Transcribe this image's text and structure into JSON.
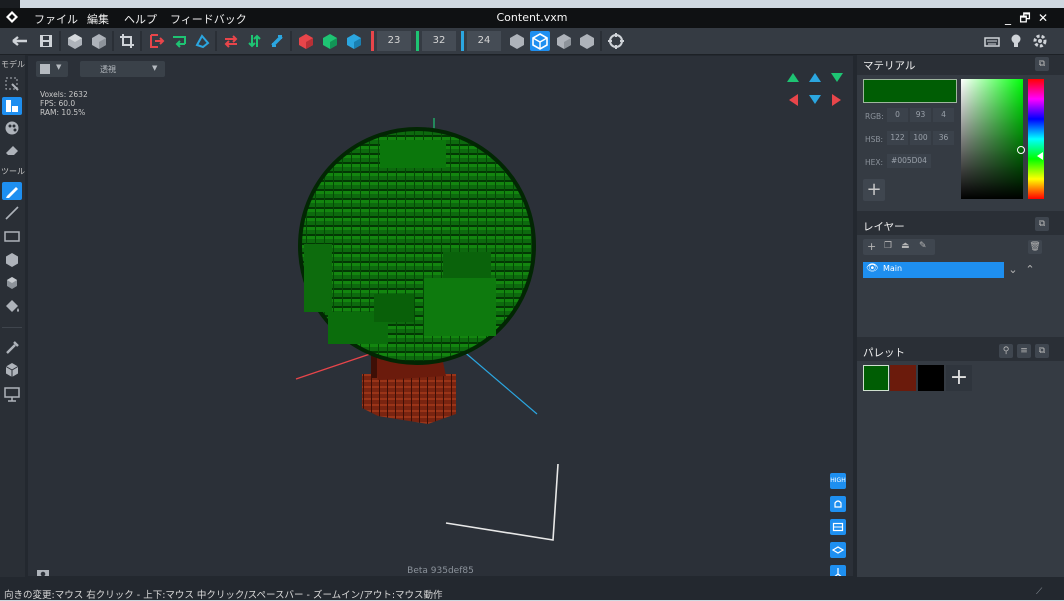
{
  "menu": {
    "app_icon": "diamond-logo-icon",
    "items": [
      "ファイル",
      "編集",
      "ヘルプ",
      "フィードバック"
    ],
    "title": "Content.vxm",
    "window_controls": [
      "_",
      "🗗",
      "✕"
    ]
  },
  "toolbar": {
    "numbers": [
      "23",
      "32",
      "24"
    ],
    "icons": [
      "back-arrow-icon",
      "save-icon",
      "voxel-select-icon",
      "cube-icon",
      "crop-icon",
      "export-red-icon",
      "export-green-icon",
      "rotate-icon",
      "swap-horizontal-icon",
      "swap-vertical-icon",
      "swap-icon",
      "cube-red-icon",
      "cube-green-icon",
      "cube-blue-icon",
      "cube-gray-icon",
      "cube-selected-icon",
      "cube-gray2-icon",
      "cube-gray3-icon",
      "target-icon",
      "keyboard-icon",
      "lightbulb-icon",
      "settings-icon"
    ],
    "accent_red": "#e8454a",
    "accent_green": "#1ec473",
    "accent_blue": "#2ba6e0"
  },
  "leftbar": {
    "model_label": "モデル",
    "tool_label": "ツール"
  },
  "viewport": {
    "view_mode": "透視",
    "stats": [
      "Voxels: 2632",
      "FPS: 60.0",
      "RAM: 10.5%"
    ],
    "version": "Beta 935def85",
    "quality_badge": "HIGH"
  },
  "material": {
    "title": "マテリアル",
    "color": "#005D04",
    "rgb_label": "RGB:",
    "rgb": [
      "0",
      "93",
      "4"
    ],
    "hsb_label": "HSB:",
    "hsb": [
      "122",
      "100",
      "36"
    ],
    "hex_label": "HEX:",
    "hex": "#005D04"
  },
  "layers": {
    "title": "レイヤー",
    "items": [
      {
        "name": "Main"
      }
    ]
  },
  "palette": {
    "title": "パレット",
    "colors": [
      "#005d04",
      "#6b1b0c",
      "#000000"
    ]
  },
  "status": {
    "text": "向きの変更:マウス 右クリック - 上下:マウス 中クリック/スペースバー - ズームイン/アウト:マウス動作"
  }
}
